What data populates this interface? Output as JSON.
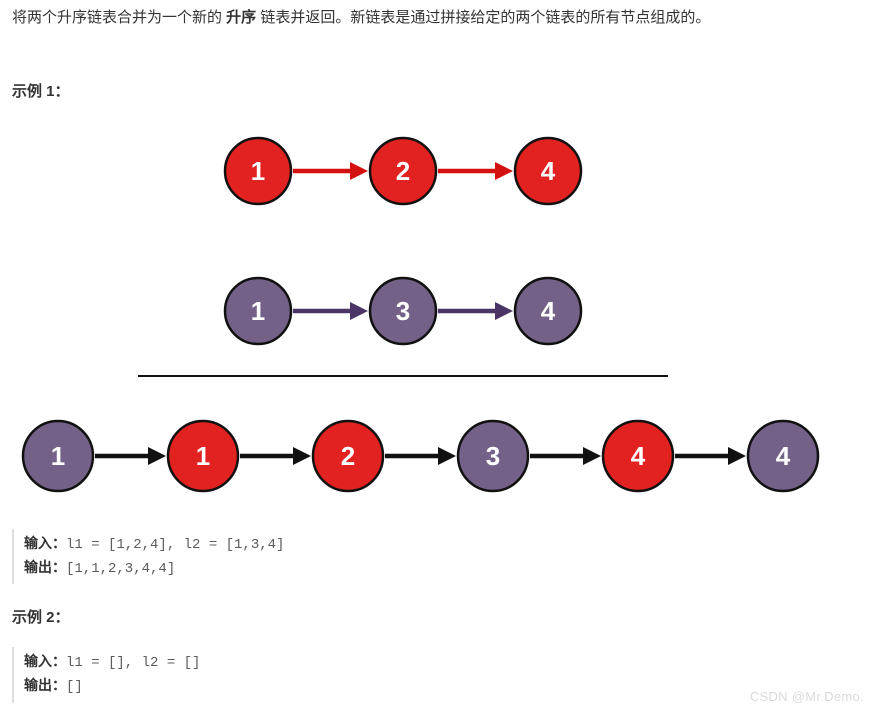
{
  "intro": {
    "pre": "将两个升序链表合并为一个新的 ",
    "bold": "升序",
    "post": " 链表并返回。新链表是通过拼接给定的两个链表的所有节点组成的。 "
  },
  "example1": {
    "heading": "示例 1：",
    "list1": [
      {
        "value": "1",
        "color": "red"
      },
      {
        "value": "2",
        "color": "red"
      },
      {
        "value": "4",
        "color": "red"
      }
    ],
    "list2": [
      {
        "value": "1",
        "color": "purple"
      },
      {
        "value": "3",
        "color": "purple"
      },
      {
        "value": "4",
        "color": "purple"
      }
    ],
    "merged": [
      {
        "value": "1",
        "color": "purple"
      },
      {
        "value": "1",
        "color": "red"
      },
      {
        "value": "2",
        "color": "red"
      },
      {
        "value": "3",
        "color": "purple"
      },
      {
        "value": "4",
        "color": "red"
      },
      {
        "value": "4",
        "color": "purple"
      }
    ],
    "io": {
      "input_label": "输入：",
      "input_code": "l1 = [1,2,4], l2 = [1,3,4]",
      "output_label": "输出：",
      "output_code": "[1,1,2,3,4,4]"
    }
  },
  "example2": {
    "heading": "示例 2：",
    "io": {
      "input_label": "输入：",
      "input_code": "l1 = [], l2 = []",
      "output_label": "输出：",
      "output_code": "[]"
    }
  },
  "colors": {
    "red_fill": "#e22121",
    "red_arrow": "#d31111",
    "purple_fill": "#746187",
    "purple_arrow": "#4b3566",
    "black_arrow": "#111111"
  },
  "watermark": "CSDN @Mr.Demo."
}
